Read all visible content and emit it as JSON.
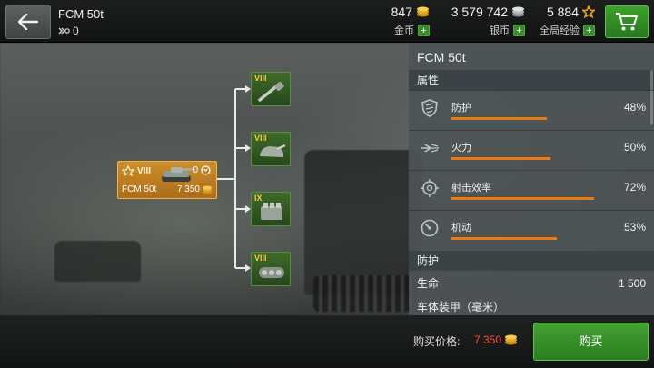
{
  "header": {
    "vehicle_name": "FCM 50t",
    "xp_value": "0",
    "gold": {
      "value": "847",
      "label": "金币"
    },
    "silver": {
      "value": "3 579 742",
      "label": "银币"
    },
    "free_xp": {
      "value": "5 884",
      "label": "全局经验"
    },
    "plus_symbol": "+"
  },
  "tree": {
    "vehicle": {
      "tier": "VIII",
      "name": "FCM 50t",
      "xp": "0",
      "price": "7 350"
    },
    "modules": [
      {
        "tier": "VIII",
        "icon": "gun-icon"
      },
      {
        "tier": "VIII",
        "icon": "turret-icon"
      },
      {
        "tier": "IX",
        "icon": "engine-icon"
      },
      {
        "tier": "VIII",
        "icon": "tracks-icon"
      }
    ]
  },
  "panel": {
    "title": "FCM 50t",
    "attributes_header": "属性",
    "stats": [
      {
        "label": "防护",
        "value": "48%",
        "level": 0.48,
        "icon": "shield-icon"
      },
      {
        "label": "火力",
        "value": "50%",
        "level": 0.5,
        "icon": "firepower-icon"
      },
      {
        "label": "射击效率",
        "value": "72%",
        "level": 0.72,
        "icon": "crosshair-icon"
      },
      {
        "label": "机动",
        "value": "53%",
        "level": 0.53,
        "icon": "speedometer-icon"
      }
    ],
    "protection_header": "防护",
    "hp_label": "生命",
    "hp_value": "1 500",
    "hull_armor_label": "车体装甲（毫米）"
  },
  "footer": {
    "price_label": "购买价格:",
    "price_value": "7 350",
    "buy_label": "购买"
  },
  "colors": {
    "accent_orange": "#e87a16",
    "price_red": "#ff4a3c",
    "buy_green": "#2a7c1f",
    "node_orange": "#d69228",
    "module_green": "#3e6a2a"
  }
}
